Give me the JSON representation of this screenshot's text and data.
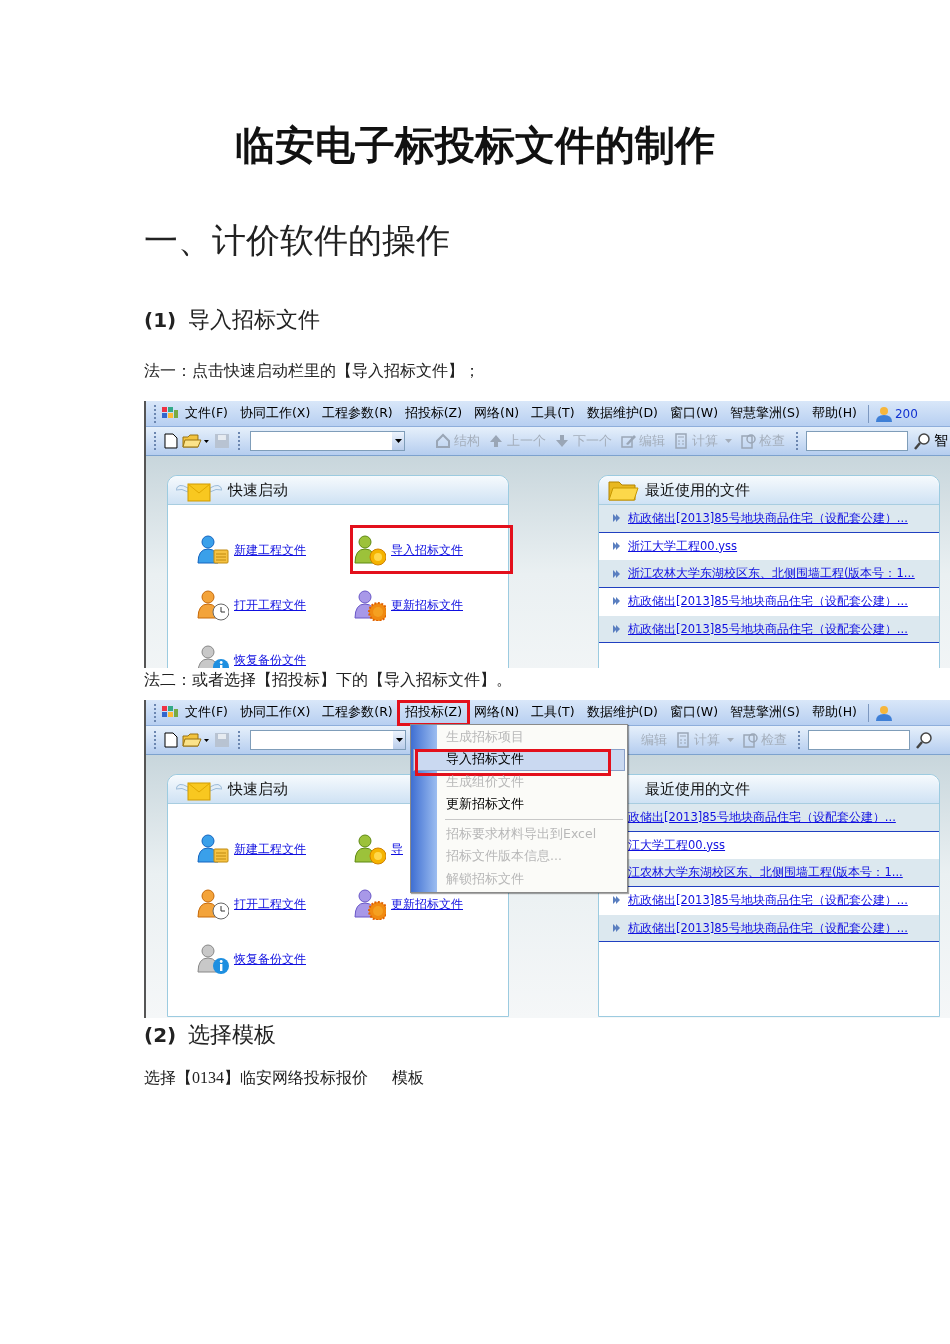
{
  "blocks": [
    {
      "kind": "title",
      "text": "临安电子标投标文件的制作"
    },
    {
      "kind": "heading",
      "text": "一、计价软件的操作"
    },
    {
      "kind": "step",
      "number": "(1)",
      "text": "导入招标文件"
    },
    {
      "kind": "paragraph",
      "text": "法一：点击快速启动栏里的【导入招标文件】；"
    },
    {
      "kind": "screenshot",
      "menubar": [
        {
          "label": "文件(F)",
          "annotated": false
        },
        {
          "label": "协同工作(X)",
          "annotated": false
        },
        {
          "label": "工程参数(R)",
          "annotated": false
        },
        {
          "label": "招投标(Z)",
          "annotated": false
        },
        {
          "label": "网络(N)",
          "annotated": false
        },
        {
          "label": "工具(T)",
          "annotated": false
        },
        {
          "label": "数据维护(D)",
          "annotated": false
        },
        {
          "label": "窗口(W)",
          "annotated": false
        },
        {
          "label": "智慧擎洲(S)",
          "annotated": false
        },
        {
          "label": "帮助(H)",
          "annotated": false
        }
      ],
      "account": "200",
      "toolbar": {
        "buttons": [
          {
            "kind": "structure",
            "label": "结构",
            "disabled": true
          },
          {
            "kind": "prev",
            "label": "上一个",
            "disabled": true
          },
          {
            "kind": "next",
            "label": "下一个",
            "disabled": true
          },
          {
            "kind": "edit",
            "label": "编辑",
            "disabled": true
          },
          {
            "kind": "calc",
            "label": "计算",
            "disabled": true
          },
          {
            "kind": "check",
            "label": "检查",
            "disabled": true
          }
        ],
        "search_label": "智"
      },
      "quick_panel": {
        "title": "快速启动",
        "items": [
          {
            "kind": "new",
            "label": "新建工程文件",
            "annotated": false
          },
          {
            "kind": "import",
            "label": "导入招标文件",
            "annotated": true
          },
          {
            "kind": "open",
            "label": "打开工程文件",
            "annotated": false
          },
          {
            "kind": "update",
            "label": "更新招标文件",
            "annotated": false
          },
          {
            "kind": "restore",
            "label": "恢复备份文件",
            "annotated": false
          }
        ]
      },
      "recent_panel": {
        "title": "最近使用的文件",
        "files": [
          "杭政储出[2013]85号地块商品住宅（设配套公建）...",
          "浙江大学工程00.yss",
          "浙江农林大学东湖校区东、北侧围墙工程(版本号：1...",
          "杭政储出[2013]85号地块商品住宅（设配套公建）...",
          "杭政储出[2013]85号地块商品住宅（设配套公建）..."
        ]
      }
    },
    {
      "kind": "paragraph",
      "text": "法二：或者选择【招投标】下的【导入招标文件】。"
    },
    {
      "kind": "screenshot",
      "menubar": [
        {
          "label": "文件(F)",
          "annotated": false
        },
        {
          "label": "协同工作(X)",
          "annotated": false
        },
        {
          "label": "工程参数(R)",
          "annotated": false
        },
        {
          "label": "招投标(Z)",
          "annotated": true
        },
        {
          "label": "网络(N)",
          "annotated": false
        },
        {
          "label": "工具(T)",
          "annotated": false
        },
        {
          "label": "数据维护(D)",
          "annotated": false
        },
        {
          "label": "窗口(W)",
          "annotated": false
        },
        {
          "label": "智慧擎洲(S)",
          "annotated": false
        },
        {
          "label": "帮助(H)",
          "annotated": false
        }
      ],
      "toolbar": {
        "buttons": [
          {
            "kind": "edit",
            "label": "编辑",
            "disabled": true
          },
          {
            "kind": "calc",
            "label": "计算",
            "disabled": true
          },
          {
            "kind": "check",
            "label": "检查",
            "disabled": true
          }
        ]
      },
      "quick_panel": {
        "title": "快速启动",
        "items": [
          {
            "kind": "new",
            "label": "新建工程文件",
            "annotated": false
          },
          {
            "kind": "import",
            "label": "导",
            "annotated": false
          },
          {
            "kind": "open",
            "label": "打开工程文件",
            "annotated": false
          },
          {
            "kind": "update",
            "label": "更新招标文件",
            "annotated": false
          },
          {
            "kind": "restore",
            "label": "恢复备份文件",
            "annotated": false
          }
        ]
      },
      "recent_panel": {
        "title": "最近使用的文件",
        "files": [
          "政储出[2013]85号地块商品住宅（设配套公建）...",
          "江大学工程00.yss",
          "江农林大学东湖校区东、北侧围墙工程(版本号：1...",
          "杭政储出[2013]85号地块商品住宅（设配套公建）...",
          "杭政储出[2013]85号地块商品住宅（设配套公建）..."
        ]
      },
      "menu": {
        "items": [
          {
            "kind": "item",
            "label": "生成招标项目",
            "disabled": true,
            "selected": false,
            "annotated": false
          },
          {
            "kind": "item",
            "label": "导入招标文件",
            "disabled": false,
            "selected": true,
            "annotated": true
          },
          {
            "kind": "item",
            "label": "生成组价文件",
            "disabled": true,
            "selected": false,
            "annotated": false
          },
          {
            "kind": "item",
            "label": "更新招标文件",
            "disabled": false,
            "selected": false,
            "annotated": false
          },
          {
            "kind": "separator"
          },
          {
            "kind": "item",
            "label": "招标要求材料导出到Excel",
            "disabled": true,
            "selected": false,
            "annotated": false
          },
          {
            "kind": "item",
            "label": "招标文件版本信息...",
            "disabled": true,
            "selected": false,
            "annotated": false
          },
          {
            "kind": "item",
            "label": "解锁招标文件",
            "disabled": true,
            "selected": false,
            "annotated": false
          }
        ]
      }
    },
    {
      "kind": "step",
      "number": "(2)",
      "text": "选择模板"
    },
    {
      "kind": "paragraph",
      "text": "选择【0134】临安网络投标报价      模板"
    }
  ]
}
